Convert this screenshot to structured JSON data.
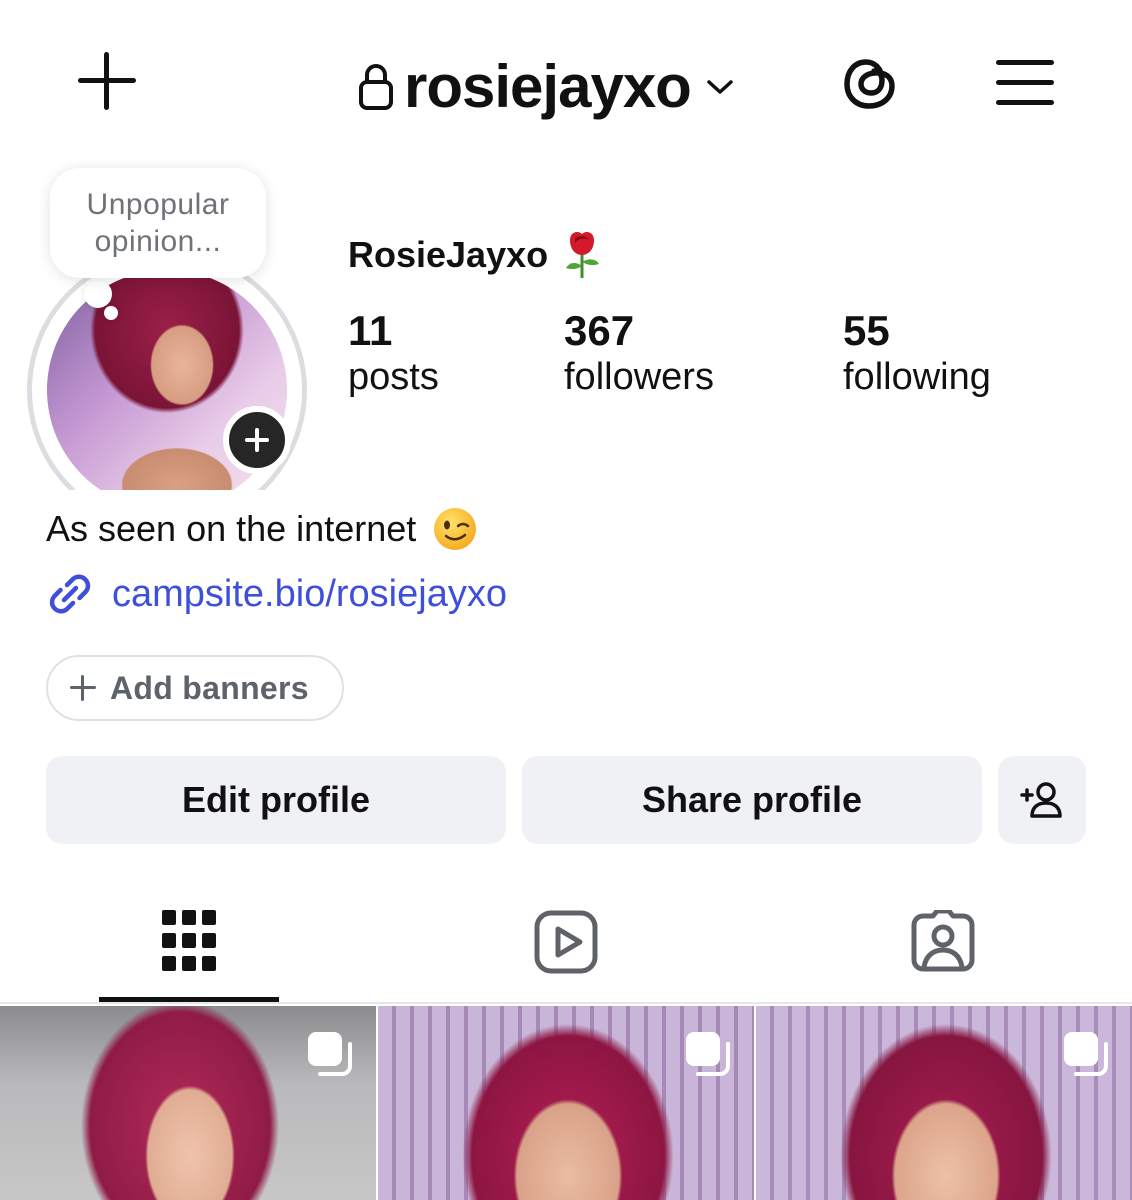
{
  "header": {
    "username": "rosiejayxo",
    "icons": {
      "create": "plus-icon",
      "private": "lock-icon",
      "switch_account": "chevron-down-icon",
      "threads": "threads-icon",
      "menu": "hamburger-menu-icon"
    }
  },
  "profile": {
    "note_line1": "Unpopular",
    "note_line2": "opinion...",
    "display_name": "RosieJayxo",
    "display_name_emoji": "rose-icon",
    "stats": [
      {
        "value": "11",
        "label": "posts"
      },
      {
        "value": "367",
        "label": "followers"
      },
      {
        "value": "55",
        "label": "following"
      }
    ],
    "bio": "As seen on the internet",
    "bio_emoji": "winking-face-icon",
    "link": "campsite.bio/rosiejayxo",
    "link_color": "#3e4fd8",
    "add_banners_label": "Add banners"
  },
  "actions": {
    "edit_label": "Edit profile",
    "share_label": "Share profile",
    "suggest_icon": "add-person-icon"
  },
  "tabs": [
    {
      "name": "posts-grid",
      "icon": "grid-icon",
      "active": true
    },
    {
      "name": "reels",
      "icon": "reels-icon",
      "active": false
    },
    {
      "name": "tagged",
      "icon": "tagged-person-icon",
      "active": false
    }
  ],
  "posts": [
    {
      "type": "carousel"
    },
    {
      "type": "carousel"
    },
    {
      "type": "carousel"
    }
  ]
}
